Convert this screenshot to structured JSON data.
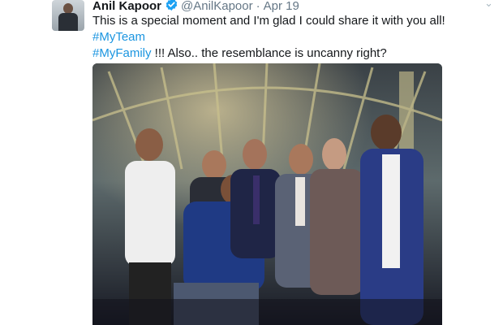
{
  "tweet": {
    "author_name": "Anil Kapoor",
    "author_handle": "@AnilKapoor",
    "separator": "·",
    "timestamp": "Apr 19",
    "verified": true,
    "text_part1": "This is a special moment and I'm glad I could share it with you all! ",
    "hashtag1": "#MyTeam",
    "hashtag2": "#MyFamily",
    "text_part2": " !!!  Also.. the resemblance is uncanny right?",
    "icons": {
      "verified": "verified-badge-icon",
      "more": "chevron-down-icon"
    },
    "colors": {
      "hashtag": "#1b95e0",
      "verified": "#1da1f2",
      "secondary_text": "#657786"
    }
  }
}
